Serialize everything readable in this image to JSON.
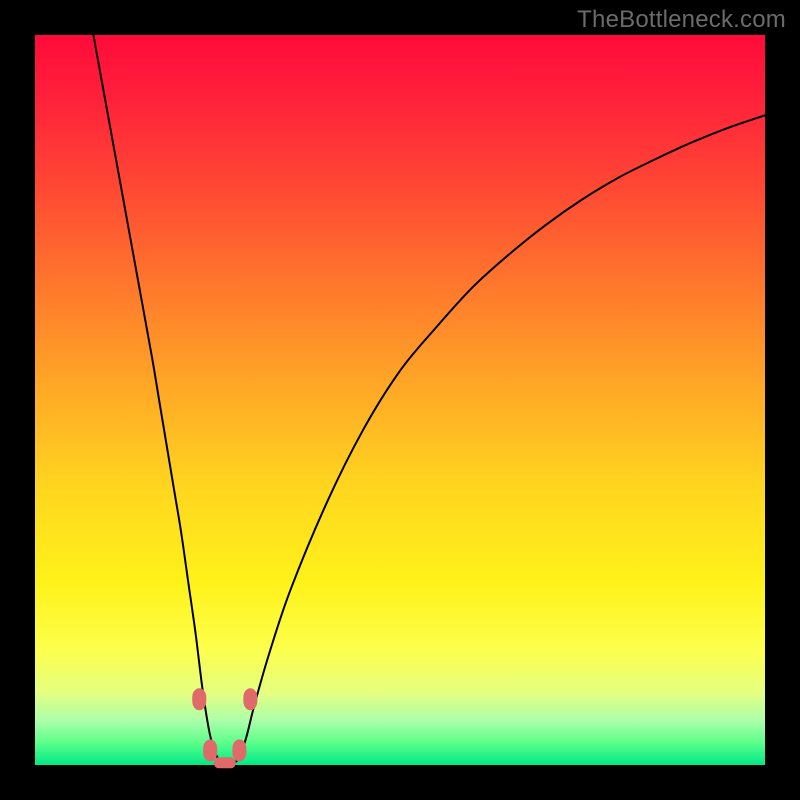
{
  "watermark": "TheBottleneck.com",
  "chart_data": {
    "type": "line",
    "title": "",
    "xlabel": "",
    "ylabel": "",
    "xlim": [
      0,
      100
    ],
    "ylim": [
      0,
      100
    ],
    "gradient_stops": [
      {
        "pct": 0,
        "color": "#ff0b3a"
      },
      {
        "pct": 8,
        "color": "#ff1f3b"
      },
      {
        "pct": 20,
        "color": "#ff4534"
      },
      {
        "pct": 35,
        "color": "#ff7a2c"
      },
      {
        "pct": 48,
        "color": "#ffa726"
      },
      {
        "pct": 62,
        "color": "#ffd61f"
      },
      {
        "pct": 75,
        "color": "#fff21a"
      },
      {
        "pct": 84,
        "color": "#fdff4a"
      },
      {
        "pct": 90,
        "color": "#e6ff80"
      },
      {
        "pct": 94,
        "color": "#aaffaa"
      },
      {
        "pct": 97,
        "color": "#5bff8a"
      },
      {
        "pct": 100,
        "color": "#00e887"
      }
    ],
    "series": [
      {
        "name": "bottleneck-curve",
        "x": [
          8,
          10,
          12,
          14,
          16,
          17,
          18,
          19,
          20,
          21,
          22,
          23,
          24,
          25,
          26,
          27,
          28,
          29,
          30,
          32,
          35,
          40,
          45,
          50,
          55,
          60,
          65,
          70,
          75,
          80,
          85,
          90,
          95,
          100
        ],
        "y": [
          100,
          89,
          78,
          67,
          56,
          50,
          44,
          38,
          32,
          25,
          18,
          10,
          4,
          1,
          0.3,
          0.3,
          1,
          4,
          8,
          15,
          24,
          36,
          46,
          54,
          60,
          65.5,
          70,
          74,
          77.5,
          80.5,
          83,
          85.3,
          87.3,
          89
        ]
      }
    ],
    "markers": [
      {
        "x": 22.5,
        "y": 9
      },
      {
        "x": 29.5,
        "y": 9
      },
      {
        "x": 24.0,
        "y": 2
      },
      {
        "x": 28.0,
        "y": 2
      }
    ],
    "flat_bottom": {
      "x0": 24.5,
      "x1": 27.5,
      "y": 0.3
    }
  }
}
